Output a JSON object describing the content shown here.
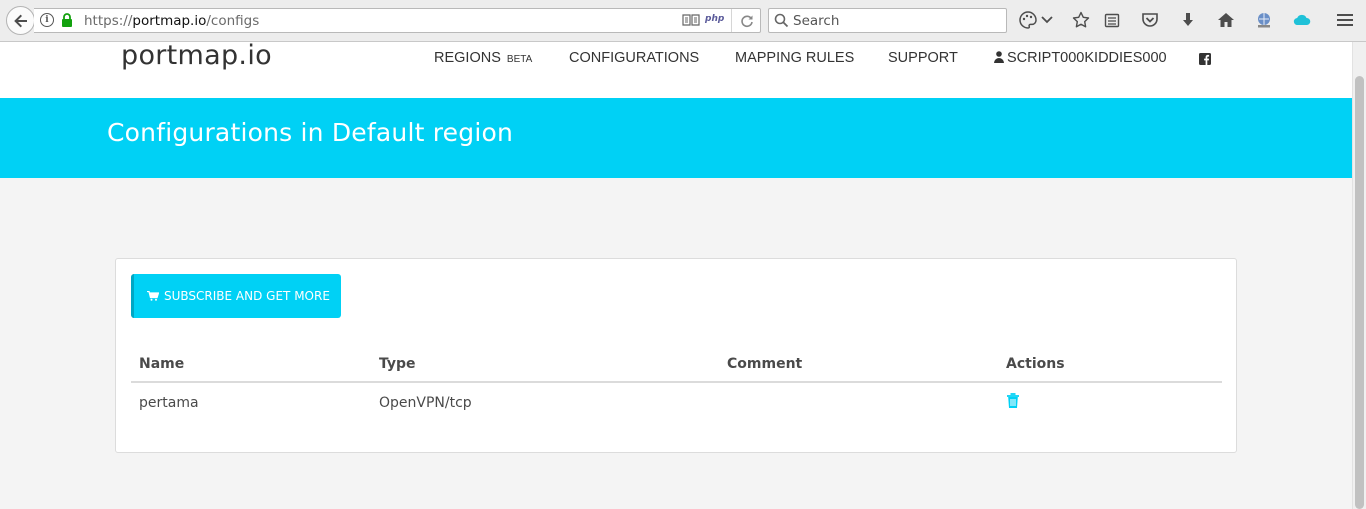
{
  "browser": {
    "url_prefix": "https://",
    "url_host": "portmap.io",
    "url_path": "/configs",
    "search_placeholder": "Search",
    "php_badge": "php"
  },
  "site": {
    "logo": "portmap.io",
    "nav": {
      "regions": "REGIONS",
      "regions_badge": "BETA",
      "configurations": "CONFIGURATIONS",
      "mapping_rules": "MAPPING RULES",
      "support": "SUPPORT",
      "user": "SCRIPT000KIDDIES000"
    }
  },
  "hero": {
    "title": "Configurations in Default region"
  },
  "panel": {
    "subscribe_label": "SUBSCRIBE AND GET MORE",
    "columns": [
      "Name",
      "Type",
      "Comment",
      "Actions"
    ],
    "rows": [
      {
        "name": "pertama",
        "type": "OpenVPN/tcp",
        "comment": ""
      }
    ]
  },
  "colors": {
    "accent": "#00d1f5",
    "accent_dark": "#00a7c4"
  }
}
